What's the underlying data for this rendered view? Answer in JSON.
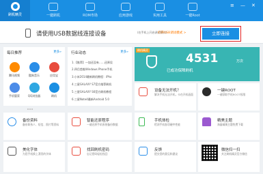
{
  "nav": {
    "brand_label": "刷机精灵",
    "tabs": [
      {
        "label": "一键刷机"
      },
      {
        "label": "ROM市场"
      },
      {
        "label": "应用游戏"
      },
      {
        "label": "实用工具"
      },
      {
        "label": "一键Root"
      }
    ]
  },
  "connect": {
    "message": "请使用USB数据线连接设备",
    "sub": "(在手机上开启调试模式)",
    "link": "打开USB调试模式 >",
    "button": "立即连接"
  },
  "daily": {
    "title": "每日推荐",
    "more": "更多»",
    "apps": [
      {
        "label": "腾讯视频"
      },
      {
        "label": "酷狗音乐"
      },
      {
        "label": "应用宝"
      },
      {
        "label": "手机管家"
      },
      {
        "label": "QQ浏览器"
      },
      {
        "label": "刷机"
      }
    ]
  },
  "industry": {
    "title": "行业动态",
    "more": "更多»",
    "items": [
      "1.【推荐】一加还没有……还原设",
      "2.四月首推Windows Phone手机",
      "3.小米2014最新刷机教程：iPho",
      "4.三星GALAXY S7官方推荐刷机",
      "5.三星GALAXY S6官方刷机教程",
      "6.三星Note4最新Android 5.0"
    ]
  },
  "banner": {
    "tag": "刷机精灵",
    "count": "4531",
    "unit": "万次",
    "text": "已成功保障刷机"
  },
  "tiles": [
    {
      "title": "设备无法开机？",
      "desc": "解决手机无法开机，卡在开机画面"
    },
    {
      "title": "一键ROOT",
      "desc": "一键获取手机ROOT权限"
    },
    {
      "title": "备份资料",
      "desc": "备份联系人、短信、照片等资料"
    },
    {
      "title": "智能还原程序",
      "desc": "一键还原手机系统备份数据"
    },
    {
      "title": "手机体检",
      "desc": "检测手机各项硬件性能"
    },
    {
      "title": "精美主题",
      "desc": "海量精美主题免费下载"
    },
    {
      "title": "美化字体",
      "desc": "为您手机换上漂亮的字体"
    },
    {
      "title": "找回刷机密码",
      "desc": "忘记密码轻松找回"
    },
    {
      "title": "反馈",
      "desc": "提交您的意见和建议"
    },
    {
      "title": "微信扫一扫",
      "desc": "关注刷机精灵官方微信"
    }
  ],
  "colors": {
    "nav": "#1a8fe3",
    "connect_button": "#1a8fe3",
    "highlight": "#e02020",
    "banner": "#38b5b3"
  }
}
